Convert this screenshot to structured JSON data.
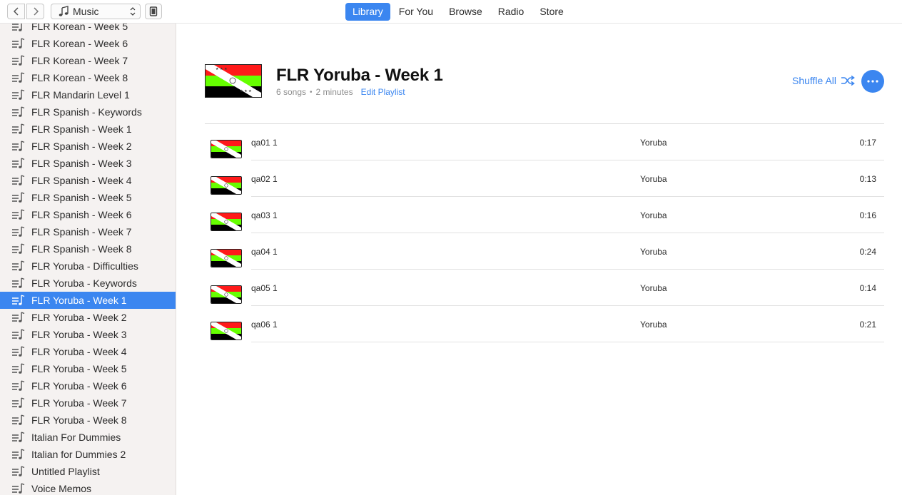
{
  "toolbar": {
    "media_kind": "Music",
    "tabs": [
      {
        "label": "Library",
        "active": true
      },
      {
        "label": "For You",
        "active": false
      },
      {
        "label": "Browse",
        "active": false
      },
      {
        "label": "Radio",
        "active": false
      },
      {
        "label": "Store",
        "active": false
      }
    ],
    "accent_color": "#3b86f0"
  },
  "sidebar": {
    "items": [
      {
        "label": "FLR Korean - Week 5"
      },
      {
        "label": "FLR Korean - Week 6"
      },
      {
        "label": "FLR Korean - Week 7"
      },
      {
        "label": "FLR Korean - Week 8"
      },
      {
        "label": "FLR Mandarin Level 1"
      },
      {
        "label": "FLR Spanish - Keywords"
      },
      {
        "label": "FLR Spanish - Week 1"
      },
      {
        "label": "FLR Spanish - Week 2"
      },
      {
        "label": "FLR Spanish - Week 3"
      },
      {
        "label": "FLR Spanish - Week 4"
      },
      {
        "label": "FLR Spanish - Week 5"
      },
      {
        "label": "FLR Spanish - Week 6"
      },
      {
        "label": "FLR Spanish - Week 7"
      },
      {
        "label": "FLR Spanish - Week 8"
      },
      {
        "label": "FLR Yoruba - Difficulties"
      },
      {
        "label": "FLR Yoruba - Keywords"
      },
      {
        "label": "FLR Yoruba - Week 1",
        "selected": true
      },
      {
        "label": "FLR Yoruba - Week 2"
      },
      {
        "label": "FLR Yoruba - Week 3"
      },
      {
        "label": "FLR Yoruba - Week 4"
      },
      {
        "label": "FLR Yoruba - Week 5"
      },
      {
        "label": "FLR Yoruba - Week 6"
      },
      {
        "label": "FLR Yoruba - Week 7"
      },
      {
        "label": "FLR Yoruba - Week 8"
      },
      {
        "label": "Italian For Dummies"
      },
      {
        "label": "Italian for Dummies 2"
      },
      {
        "label": "Untitled Playlist"
      },
      {
        "label": "Voice Memos"
      }
    ]
  },
  "playlist": {
    "title": "FLR Yoruba - Week 1",
    "song_count": "6 songs",
    "separator": "•",
    "duration": "2 minutes",
    "edit_label": "Edit Playlist",
    "shuffle_label": "Shuffle All",
    "more_icon": "ellipsis-icon",
    "artwork_colors": {
      "red": "#ff1a1a",
      "green": "#66ff00",
      "black": "#000000"
    },
    "tracks": [
      {
        "name": "qa01 1",
        "artist": "Yoruba",
        "duration": "0:17"
      },
      {
        "name": "qa02 1",
        "artist": "Yoruba",
        "duration": "0:13"
      },
      {
        "name": "qa03 1",
        "artist": "Yoruba",
        "duration": "0:16"
      },
      {
        "name": "qa04 1",
        "artist": "Yoruba",
        "duration": "0:24"
      },
      {
        "name": "qa05 1",
        "artist": "Yoruba",
        "duration": "0:14"
      },
      {
        "name": "qa06 1",
        "artist": "Yoruba",
        "duration": "0:21"
      }
    ]
  }
}
